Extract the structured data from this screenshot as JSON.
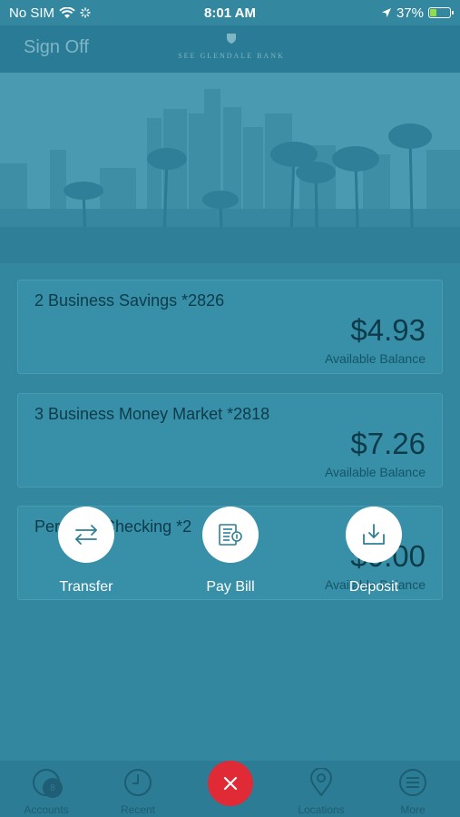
{
  "status_bar": {
    "carrier": "No SIM",
    "time": "8:01 AM",
    "battery_percent": "37%",
    "battery_level": 0.37,
    "battery_color": "#8ee04a"
  },
  "header": {
    "sign_off_label": "Sign Off",
    "logo_text": "SEE GLENDALE BANK"
  },
  "accounts": [
    {
      "name": "2 Business Savings *2826",
      "balance": "$4.93",
      "balance_label": "Available Balance"
    },
    {
      "name": "3 Business Money Market *2818",
      "balance": "$7.26",
      "balance_label": "Available Balance"
    },
    {
      "name": "Personal Checking *2",
      "balance": "$0.00",
      "balance_label": "Available Balance"
    }
  ],
  "quick_actions": [
    {
      "label": "Transfer",
      "icon": "transfer-icon"
    },
    {
      "label": "Pay Bill",
      "icon": "pay-bill-icon"
    },
    {
      "label": "Deposit",
      "icon": "deposit-icon"
    }
  ],
  "tab_bar": {
    "accounts_label": "Accounts",
    "accounts_badge": "8",
    "recent_label": "Recent",
    "close_icon": "close-icon",
    "locations_label": "Locations",
    "more_label": "More"
  },
  "colors": {
    "overlay": "#33879e",
    "close_button": "#e02a36",
    "action_circle": "#ffffff"
  }
}
